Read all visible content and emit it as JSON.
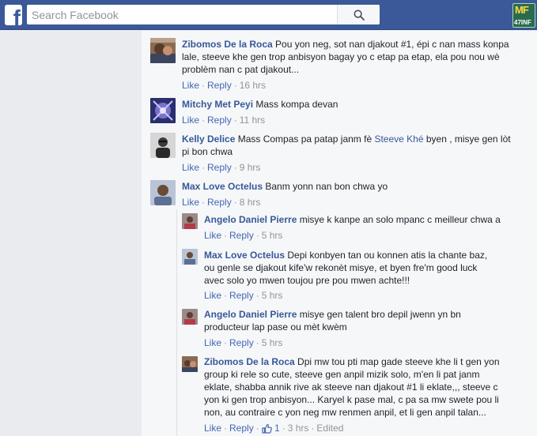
{
  "header": {
    "logo_letter": "f",
    "search_placeholder": "Search Facebook",
    "search_icon": "magnifier-icon",
    "corner_badge_top": "MF",
    "corner_badge_bottom": "47INF"
  },
  "colors": {
    "topbar": "#3b5998",
    "link": "#365899",
    "action_link": "#4267b2",
    "meta": "#90949c",
    "panel_bg": "#f6f7f9"
  },
  "comments": [
    {
      "author": "Zibomos De la Roca",
      "text_lines": [
        " Pou yon neg, sot nan djakout #1, épi c nan mass konpa",
        "lale, steeve khe gen trop anbisyon bagay yo c etap pa etap, ela pou nou wè",
        "problèm nan c pat djakout..."
      ],
      "like": "Like",
      "reply": "Reply",
      "time": "16 hrs"
    },
    {
      "author": "Mitchy Met Peyi",
      "text_lines": [
        " Mass kompa devan"
      ],
      "like": "Like",
      "reply": "Reply",
      "time": "11 hrs"
    },
    {
      "author": "Kelly Delice",
      "text_lines_parts": {
        "before": " Mass Compas pa patap janm fè ",
        "mention": "Steeve Khé",
        "after": " byen , misye gen lòt",
        "line2": "pi bon chwa"
      },
      "like": "Like",
      "reply": "Reply",
      "time": "9 hrs"
    },
    {
      "author": "Max Love Octelus",
      "text_lines": [
        " Banm yonn nan bon chwa yo"
      ],
      "like": "Like",
      "reply": "Reply",
      "time": "8 hrs"
    }
  ],
  "replies": [
    {
      "author": "Angelo Daniel Pierre",
      "text_lines": [
        " misye k kanpe an solo mpanc c meilleur chwa a"
      ],
      "like": "Like",
      "reply": "Reply",
      "time": "5 hrs"
    },
    {
      "author": "Max Love Octelus",
      "text_lines": [
        " Depi konbyen tan ou konnen atis la chante baz,",
        "ou genle se djakout kife'w rekonèt misye, et byen fre'm good luck",
        "avec solo yo mwen toujou pre pou mwen achte!!!"
      ],
      "like": "Like",
      "reply": "Reply",
      "time": "5 hrs"
    },
    {
      "author": "Angelo Daniel Pierre",
      "text_lines": [
        " misye gen talent bro depil jwenn yn bn",
        "producteur lap pase ou mèt kwèm"
      ],
      "like": "Like",
      "reply": "Reply",
      "time": "5 hrs"
    },
    {
      "author": "Zibomos De la Roca",
      "text_lines": [
        " Dpi mw tou pti map gade steeve khe li t gen yon",
        "group ki rele so cute, steeve gen anpil mizik solo, m'en li pat janm",
        "eklate, shabba annik rive ak steeve nan djakout #1 li eklate,,, steeve c",
        "yon ki gen trop anbisyon... Karyel k pase mal, c pa sa mw swete pou li",
        "non, au contraire c yon neg mw renmen anpil, et li gen anpil talan..."
      ],
      "like": "Like",
      "reply": "Reply",
      "like_count": "1",
      "time": "3 hrs",
      "edited": "Edited"
    }
  ]
}
